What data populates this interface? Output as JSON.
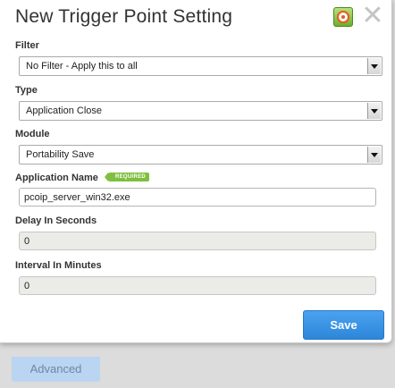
{
  "dialog": {
    "title": "New Trigger Point Setting",
    "help_icon": "help-lifebuoy-icon",
    "close_icon": "close-x-icon",
    "close_glyph": "✕"
  },
  "form": {
    "filter": {
      "label": "Filter",
      "value": "No Filter - Apply this to all"
    },
    "type": {
      "label": "Type",
      "value": "Application Close"
    },
    "module": {
      "label": "Module",
      "value": "Portability Save"
    },
    "application_name": {
      "label": "Application Name",
      "required_badge": "REQUIRED",
      "value": "pcoip_server_win32.exe"
    },
    "delay": {
      "label": "Delay In Seconds",
      "value": "0"
    },
    "interval": {
      "label": "Interval In Minutes",
      "value": "0"
    }
  },
  "actions": {
    "save_label": "Save",
    "advanced_label": "Advanced"
  },
  "colors": {
    "accent": "#2d86d9",
    "required_badge": "#7fbf3f",
    "advanced_button": "#b9d5f2"
  }
}
